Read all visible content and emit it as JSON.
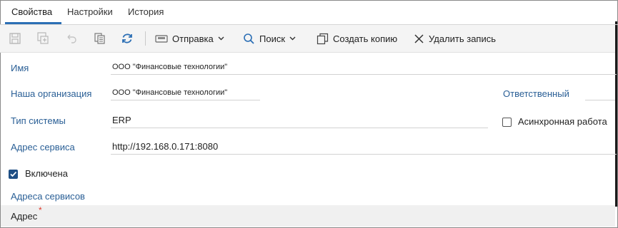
{
  "tabs": [
    {
      "label": "Свойства",
      "active": true
    },
    {
      "label": "Настройки",
      "active": false
    },
    {
      "label": "История",
      "active": false
    }
  ],
  "toolbar": {
    "send_label": "Отправка",
    "search_label": "Поиск",
    "copy_label": "Создать копию",
    "delete_label": "Удалить запись",
    "icons": [
      "save-icon",
      "save-close-icon",
      "undo-icon",
      "copy-doc-icon",
      "refresh-icon",
      "send-icon",
      "search-icon",
      "copy-icon",
      "close-icon"
    ]
  },
  "form": {
    "name": {
      "label": "Имя",
      "value": "ООО \"Финансовые технологии\""
    },
    "our_org": {
      "label": "Наша организация",
      "value": "ООО \"Финансовые технологии\""
    },
    "responsible": {
      "label": "Ответственный",
      "value": ""
    },
    "system_type": {
      "label": "Тип системы",
      "value": "ERP"
    },
    "async": {
      "label": "Асинхронная работа",
      "checked": false
    },
    "service_address": {
      "label": "Адрес сервиса",
      "value": "http://192.168.0.171:8080"
    },
    "enabled": {
      "label": "Включена",
      "checked": true
    },
    "service_addresses_section": "Адреса сервисов",
    "grid_column": "Адрес",
    "required_mark": "*"
  },
  "colors": {
    "accent": "#2c6fb5",
    "label": "#2a5f96",
    "checkbox": "#1f4f85",
    "required": "#e0392b",
    "toolbar_bg": "#f4f4f4"
  }
}
